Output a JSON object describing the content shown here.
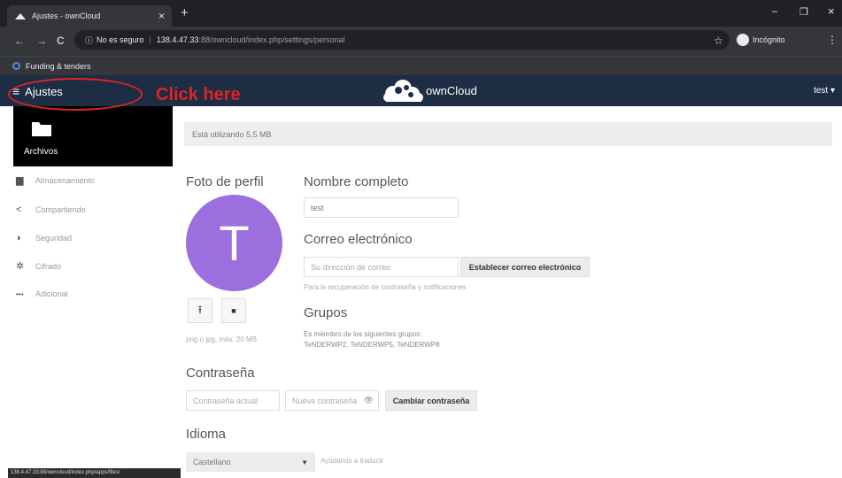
{
  "browser": {
    "tab_title": "Ajustes - ownCloud",
    "tab_close": "×",
    "new_tab": "+",
    "win_min": "–",
    "win_max": "❐",
    "win_close": "×",
    "back": "←",
    "forward": "→",
    "reload": "C",
    "security_label": "No es seguro",
    "url_host": "138.4.47.33",
    "url_rest": ":88/owncloud/index.php/settings/personal",
    "incognito_label": "Incógnito",
    "bookmark_label": "Funding & tenders",
    "status_url": "138.4.47.33:88/owncloud/index.php/apps/files/"
  },
  "header": {
    "menu_label": "Ajustes",
    "annotation": "Click here",
    "brand": "ownCloud",
    "user": "test ▾"
  },
  "apps_popup": {
    "label": "Archivos"
  },
  "sidebar": {
    "items": [
      {
        "label": "Almacenamiento",
        "icon": "folder-icon",
        "glyph": "▆"
      },
      {
        "label": "Compartiendo",
        "icon": "share-icon",
        "glyph": "<"
      },
      {
        "label": "Seguridad",
        "icon": "shield-icon",
        "glyph": "◗"
      },
      {
        "label": "Cifrado",
        "icon": "gear-icon",
        "glyph": "✲"
      },
      {
        "label": "Adicional",
        "icon": "more-icon",
        "glyph": "•••"
      }
    ]
  },
  "main": {
    "usage_text": "Está utilizando 5.5 MB",
    "profile_heading": "Foto de perfil",
    "avatar_letter": "T",
    "upload_glyph": "⭱",
    "folder_glyph": "■",
    "avatar_hint": "png o jpg, máx. 20 MB",
    "fullname_heading": "Nombre completo",
    "fullname_value": "test",
    "email_heading": "Correo electrónico",
    "email_placeholder": "Su dirección de correo",
    "email_button": "Establecer correo electrónico",
    "email_hint": "Para la recuperación de contraseña y notificaciones",
    "groups_heading": "Grupos",
    "groups_intro": "Es miembro de los siguientes grupos:",
    "groups_list": "TeNDERWP2, TeNDERWP5, TeNDERWP8",
    "password_heading": "Contraseña",
    "current_password_placeholder": "Contraseña actual",
    "new_password_placeholder": "Nueva contraseña",
    "password_button": "Cambiar contraseña",
    "language_heading": "Idioma",
    "language_value": "Castellano",
    "translate_hint": "Ayúdanos a traducir"
  },
  "colors": {
    "header_bg": "#1d2d44",
    "avatar": "#9b6fde",
    "annotation": "#e02424"
  }
}
